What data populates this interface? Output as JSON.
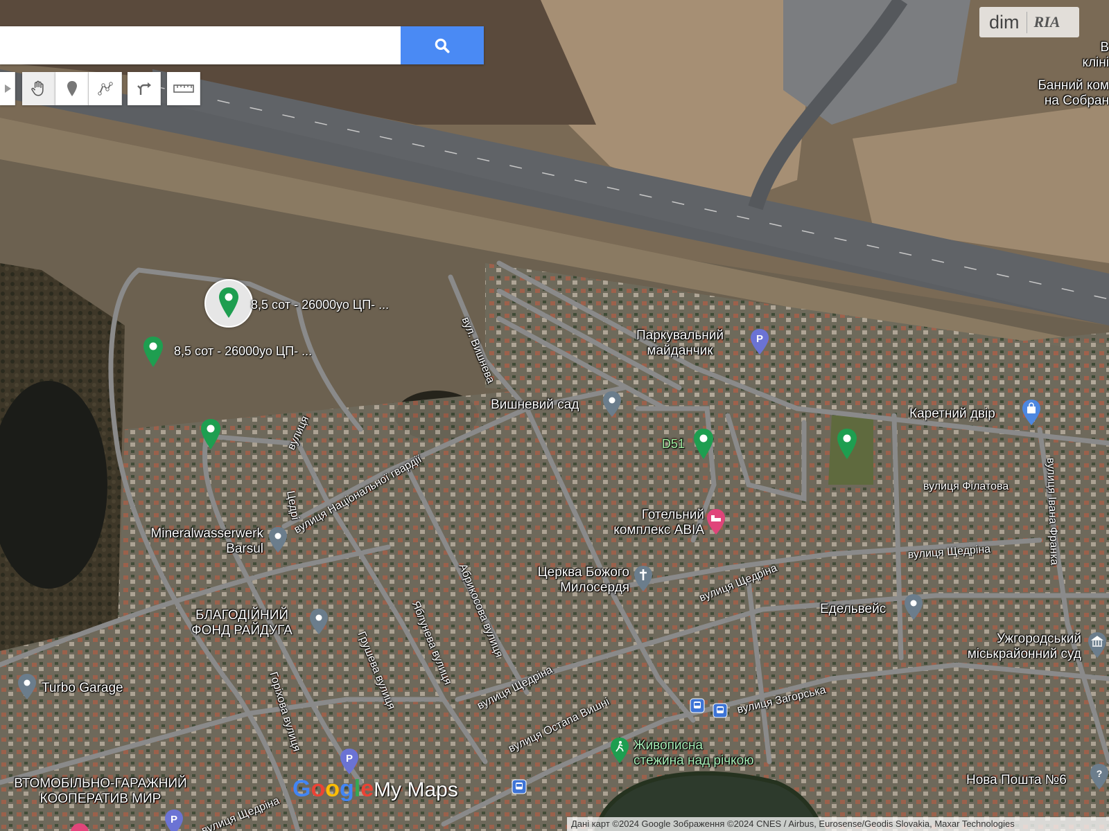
{
  "search": {
    "placeholder": "",
    "value": ""
  },
  "toolbar": {
    "tools": [
      {
        "name": "pan",
        "icon": "hand-icon"
      },
      {
        "name": "add-marker",
        "icon": "marker-icon"
      },
      {
        "name": "draw-line",
        "icon": "draw-line-icon"
      },
      {
        "name": "directions",
        "icon": "directions-icon"
      },
      {
        "name": "measure",
        "icon": "ruler-icon"
      }
    ]
  },
  "watermark": {
    "left": "dim",
    "right": "RIA"
  },
  "markers": [
    {
      "label": "8,5 сот - 26000уо ЦП- ...",
      "selected": true
    },
    {
      "label": "8,5 сот - 26000уо ЦП- ...",
      "selected": false
    },
    {
      "label": "",
      "selected": false
    },
    {
      "label": "D51",
      "selected": false
    },
    {
      "label": "",
      "selected": false
    }
  ],
  "places": {
    "parking": "Паркувальний майданчик",
    "parking_l1": "Паркувальний",
    "parking_l2": "майданчик",
    "vyshnevyi_sad": "Вишневий сад",
    "karetnyi_dvir": "Каретний двір",
    "hotel_l1": "Готельний",
    "hotel_l2": "комплекс АВІА",
    "church_l1": "Церква Божого",
    "church_l2": "Милосердя",
    "mineral_l1": "Mineralwasserwerk",
    "mineral_l2": "Barsul",
    "fond_l1": "БЛАГОДІЙНИЙ",
    "fond_l2": "ФОНД РАЙДУГА",
    "edelweiss": "Едельвейс",
    "court_l1": "Ужгородський",
    "court_l2": "міськрайонний суд",
    "turbo": "Turbo Garage",
    "garage_l1": "ВТОМОБІЛЬНО-ГАРАЖНИЙ",
    "garage_l2": "КООПЕРАТИВ МИР",
    "trail_l1": "Живописна",
    "trail_l2": "стежина над річкою",
    "novaposhta": "Нова Пошта №6",
    "bannyi_l1": "Банний ком",
    "bannyi_l2": "на Собран",
    "clinic_l1": "В",
    "clinic_l2": "кліні"
  },
  "streets": {
    "vyshneva": "вул. Вишнева",
    "nat_gvardii": "вулиця Національної гвардії",
    "vulytsia_left": "вулиця",
    "vulytsia_left2": "Цедрі",
    "filatova": "вулиця Філатова",
    "ivana_franka": "вулиця Івана Франка",
    "shchedrina_right": "вулиця Щедріна",
    "shchedrina_mid": "вулиця Щедріна",
    "shchedrina_low": "вулиця Щедріна",
    "shchedrina_bottom": "вулиця Щедріна",
    "abrykosova": "Абрикосова вулиця",
    "yablunева": "Яблунева вулиця",
    "hrusheva": "Грушева вулиця",
    "horikhova": "Горіхова вулиця",
    "ostapa_vyshni": "вулиця Остапа Вишні",
    "zahorska": "вулиця Загорська"
  },
  "logo": {
    "google": "Google",
    "mymaps": "My Maps"
  },
  "attribution": "Дані карт ©2024 Google Зображення ©2024 CNES / Airbus, Eurosense/Geodis Slovakia, Maxar Technologies",
  "colors": {
    "search_button": "#4a8af4",
    "marker_green": "#1e9e50",
    "poi_grey": "#6b7d8c"
  }
}
